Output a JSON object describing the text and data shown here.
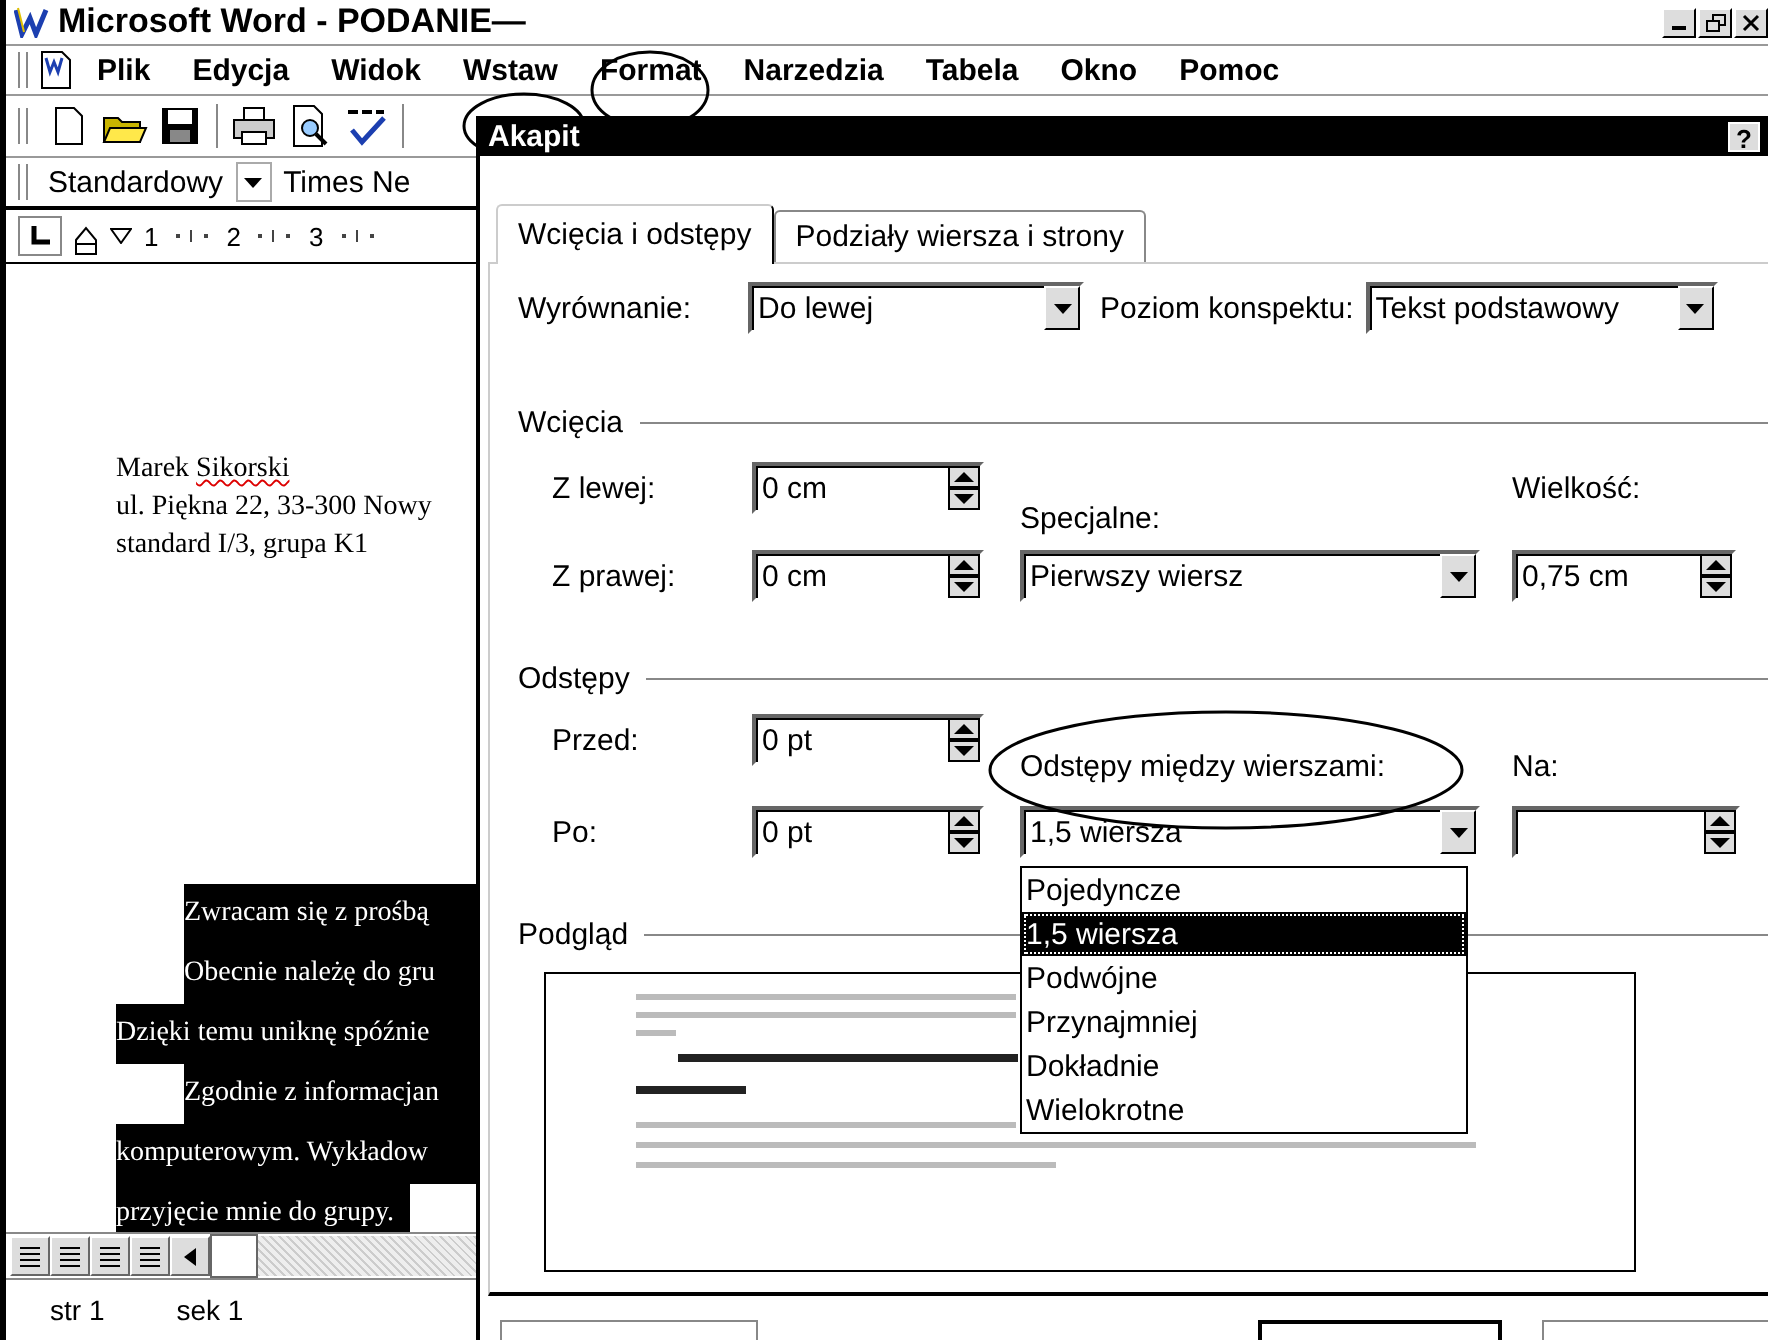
{
  "window": {
    "title": "Microsoft Word - PODANIE—"
  },
  "menu": [
    "Plik",
    "Edycja",
    "Widok",
    "Wstaw",
    "Format",
    "Narzedzia",
    "Tabela",
    "Okno",
    "Pomoc"
  ],
  "formatting": {
    "style": "Standardowy",
    "font": "Times Ne"
  },
  "ruler": {
    "numbers": [
      "1",
      "2",
      "3"
    ]
  },
  "document": {
    "lines": [
      {
        "parts": [
          {
            "text": "Marek ",
            "misspelled": false
          },
          {
            "text": "Sikorski",
            "misspelled": true
          }
        ],
        "selected": false,
        "indented": false
      },
      {
        "parts": [
          {
            "text": "ul. Piękna 22, 33-300 Nowy",
            "misspelled": false
          }
        ],
        "selected": false,
        "indented": false
      },
      {
        "parts": [
          {
            "text": "standard I/3, grupa K1",
            "misspelled": false
          }
        ],
        "selected": false,
        "indented": false
      }
    ],
    "selection": [
      {
        "text": "Zwracam się z prośbą",
        "indented": true
      },
      {
        "text": "Obecnie należę do gru",
        "indented": true
      },
      {
        "text": "Dzięki temu uniknę spóźnie",
        "indented": false
      },
      {
        "text": "Zgodnie z informacjan",
        "indented": true
      },
      {
        "text": "komputerowym. Wykładow",
        "indented": false
      },
      {
        "text": "przyjęcie mnie do grupy.",
        "indented": false
      }
    ]
  },
  "status_bar": [
    "str 1",
    "sek 1"
  ],
  "dialog": {
    "title": "Akapit",
    "help_button": "?",
    "tabs": [
      {
        "label": "Wcięcia i odstępy",
        "selected": true
      },
      {
        "label": "Podziały wiersza i strony",
        "selected": false
      }
    ],
    "alignment": {
      "label": "Wyrównanie:",
      "value": "Do lewej"
    },
    "outline": {
      "label": "Poziom konspektu:",
      "value": "Tekst podstawowy"
    },
    "indents": {
      "heading": "Wcięcia",
      "left": {
        "label": "Z lewej:",
        "value": "0 cm"
      },
      "right": {
        "label": "Z prawej:",
        "value": "0 cm"
      },
      "special": {
        "label": "Specjalne:",
        "value": "Pierwszy wiersz"
      },
      "by": {
        "label": "Wielkość:",
        "value": "0,75 cm"
      }
    },
    "spacing": {
      "heading": "Odstępy",
      "before": {
        "label": "Przed:",
        "value": "0 pt"
      },
      "after": {
        "label": "Po:",
        "value": "0 pt"
      },
      "line_spacing": {
        "label": "Odstępy między wierszami:",
        "value": "1,5 wiersza",
        "expanded": true,
        "options": [
          {
            "label": "Pojedyncze",
            "selected": false
          },
          {
            "label": "1,5 wiersza",
            "selected": true
          },
          {
            "label": "Podwójne",
            "selected": false
          },
          {
            "label": "Przynajmniej",
            "selected": false
          },
          {
            "label": "Dokładnie",
            "selected": false
          },
          {
            "label": "Wielokrotne",
            "selected": false
          }
        ]
      },
      "at": {
        "label": "Na:"
      }
    },
    "preview": {
      "heading": "Podgląd"
    }
  }
}
